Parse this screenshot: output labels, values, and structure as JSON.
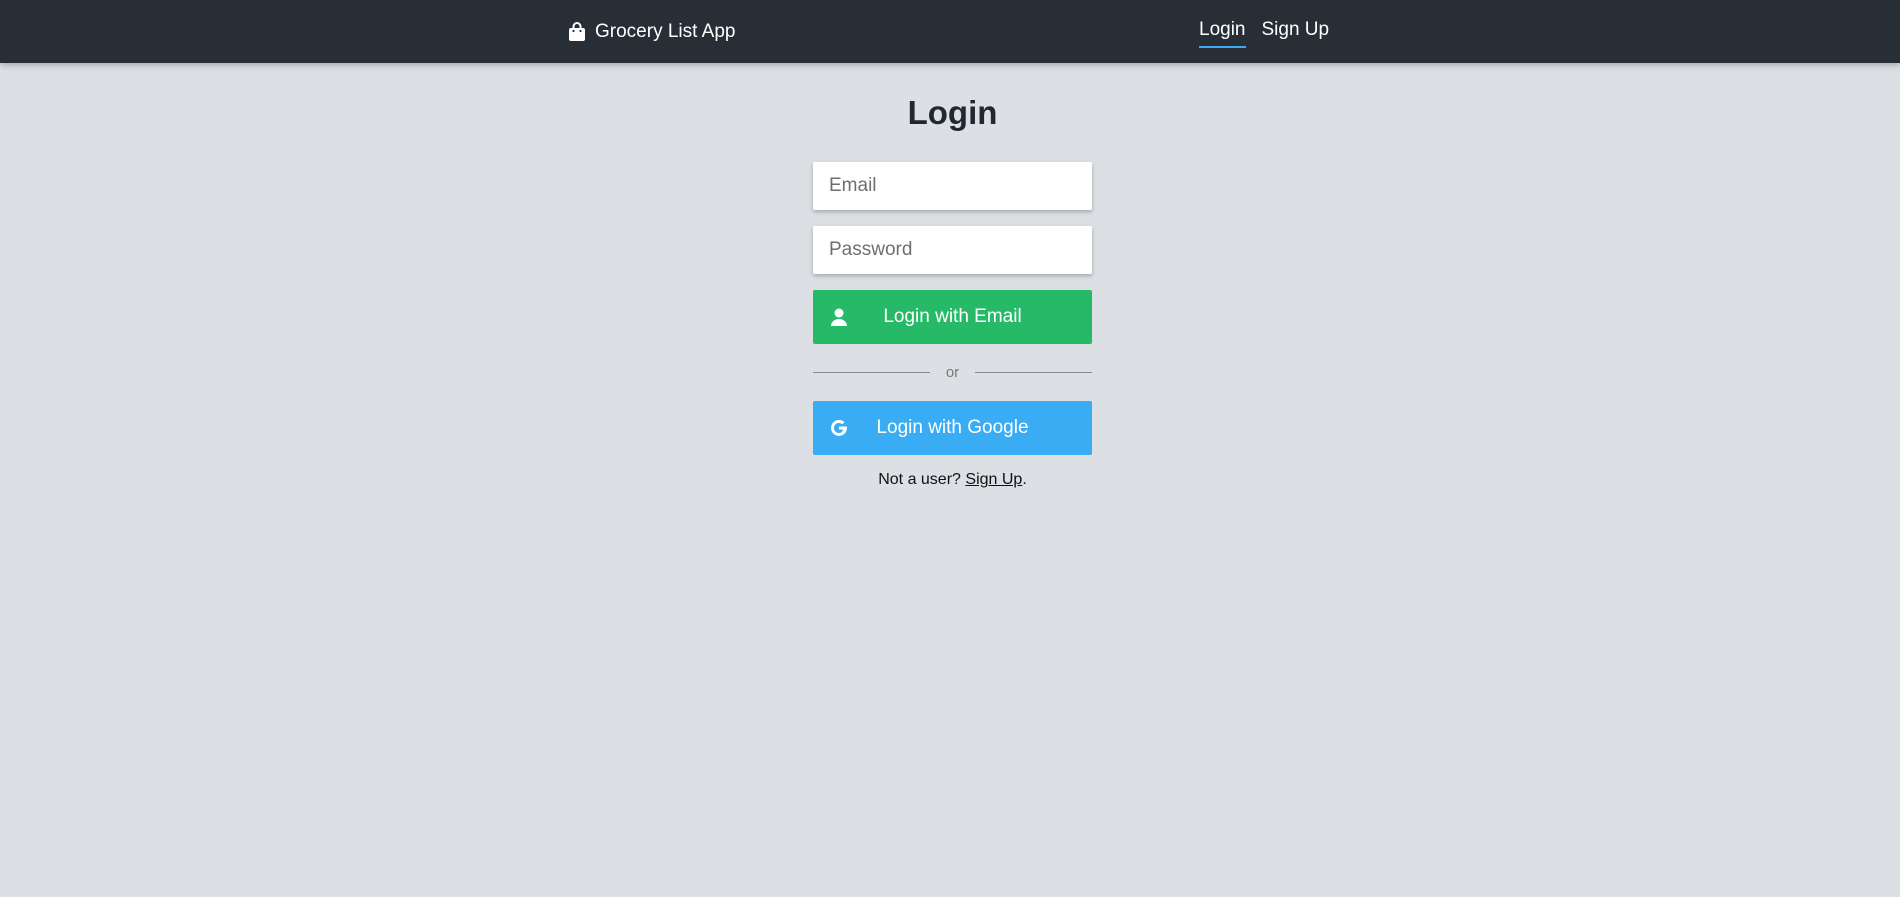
{
  "header": {
    "brand_label": "Grocery List App",
    "brand_icon": "shopping-bag-icon",
    "nav": {
      "login_label": "Login",
      "signup_label": "Sign Up",
      "active": "login"
    }
  },
  "login_form": {
    "title": "Login",
    "email_placeholder": "Email",
    "email_value": "",
    "password_placeholder": "Password",
    "password_value": "",
    "email_button_label": "Login with Email",
    "email_button_icon": "user-icon",
    "divider_text": "or",
    "google_button_label": "Login with Google",
    "google_button_icon": "google-icon",
    "signup_prompt": "Not a user?",
    "signup_link": "Sign Up",
    "signup_suffix": "."
  },
  "colors": {
    "topbar": "#282e36",
    "background": "#dcdfe3",
    "email_button": "#26ba68",
    "google_button": "#3aacf4",
    "active_underline": "#3fa9f5"
  }
}
